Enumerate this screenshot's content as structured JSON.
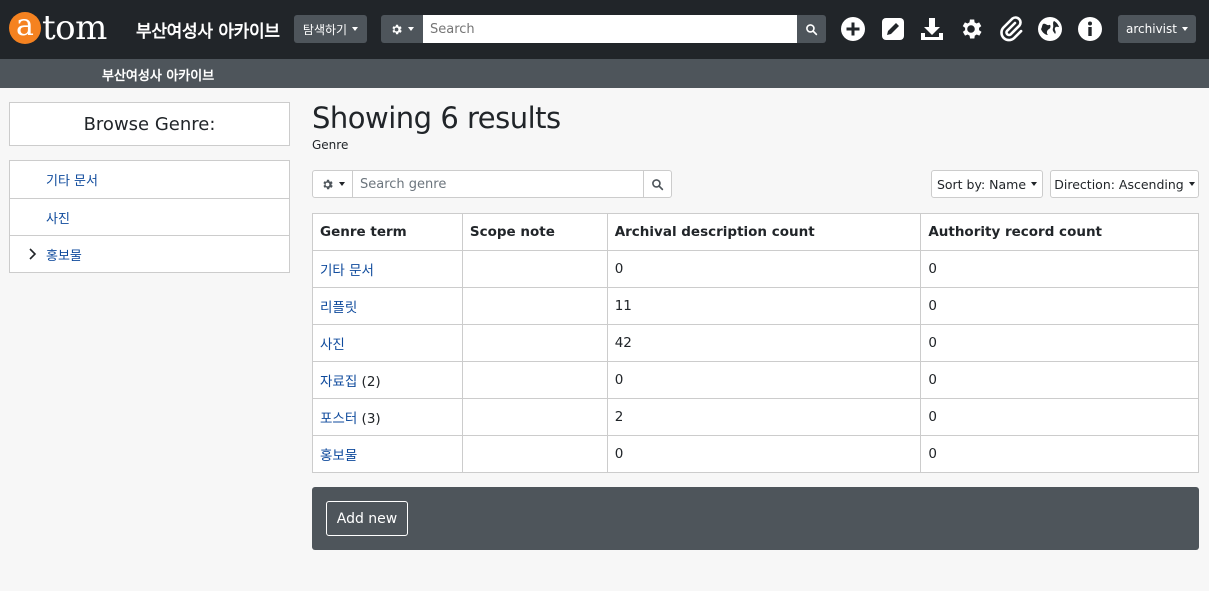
{
  "header": {
    "logo_initial": "a",
    "logo_rest": "tom",
    "site_title": "부산여성사 아카이브",
    "browse_label": "탐색하기",
    "search_placeholder": "Search",
    "user_label": "archivist",
    "icons": [
      "plus-circle-icon",
      "edit-icon",
      "download-icon",
      "gear-icon",
      "paperclip-icon",
      "globe-icon",
      "info-icon"
    ]
  },
  "subbar": {
    "title": "부산여성사 아카이브"
  },
  "sidebar": {
    "browse_title": "Browse Genre:",
    "items": [
      {
        "label": "기타 문서",
        "expandable": false
      },
      {
        "label": "사진",
        "expandable": false
      },
      {
        "label": "홍보물",
        "expandable": true
      }
    ]
  },
  "main": {
    "heading": "Showing 6 results",
    "subheading": "Genre",
    "filter_placeholder": "Search genre",
    "sort_label": "Sort by: Name",
    "direction_label": "Direction: Ascending",
    "columns": [
      "Genre term",
      "Scope note",
      "Archival description count",
      "Authority record count"
    ],
    "rows": [
      {
        "term": "기타 문서",
        "suffix": "",
        "scope": "",
        "archival": "0",
        "authority": "0"
      },
      {
        "term": "리플릿",
        "suffix": "",
        "scope": "",
        "archival": "11",
        "authority": "0"
      },
      {
        "term": "사진",
        "suffix": "",
        "scope": "",
        "archival": "42",
        "authority": "0"
      },
      {
        "term": "자료집",
        "suffix": " (2)",
        "scope": "",
        "archival": "0",
        "authority": "0"
      },
      {
        "term": "포스터",
        "suffix": " (3)",
        "scope": "",
        "archival": "2",
        "authority": "0"
      },
      {
        "term": "홍보물",
        "suffix": "",
        "scope": "",
        "archival": "0",
        "authority": "0"
      }
    ],
    "add_new_label": "Add new"
  },
  "colors": {
    "topbar": "#212529",
    "subbar": "#4e555b",
    "accent": "#f58220",
    "link": "#0e4a9c"
  }
}
